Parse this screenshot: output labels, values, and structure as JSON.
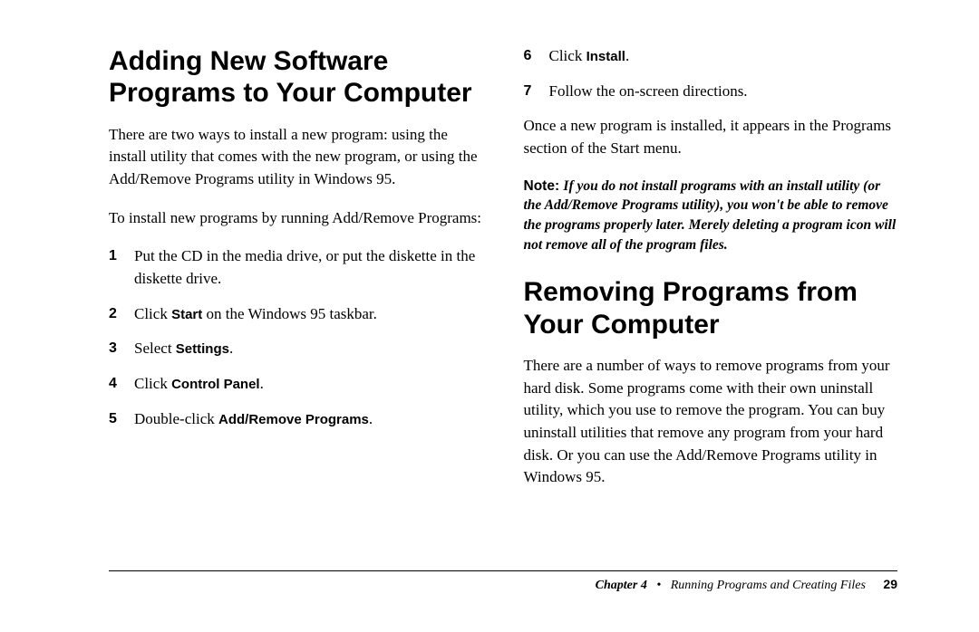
{
  "left": {
    "heading": "Adding New Software Programs to Your Computer",
    "p1": "There are two ways to install a new program: using the install utility that comes with the new program, or using the Add/Remove Programs utility in Windows 95.",
    "p2": "To install new programs by running Add/Remove Programs:",
    "steps": [
      {
        "n": "1",
        "pre": "Put the CD in the media drive, or put the diskette in the diskette drive."
      },
      {
        "n": "2",
        "pre": "Click ",
        "bold": "Start",
        "post": " on the Windows 95 taskbar."
      },
      {
        "n": "3",
        "pre": "Select ",
        "bold": "Settings",
        "post": "."
      },
      {
        "n": "4",
        "pre": "Click ",
        "bold": "Control Panel",
        "post": "."
      },
      {
        "n": "5",
        "pre": "Double-click ",
        "bold": "Add/Remove Programs",
        "post": "."
      }
    ]
  },
  "right": {
    "steps": [
      {
        "n": "6",
        "pre": "Click ",
        "bold": "Install",
        "post": "."
      },
      {
        "n": "7",
        "pre": "Follow the on-screen directions."
      }
    ],
    "p1": "Once a new program is installed, it appears in the Programs section of the Start menu.",
    "noteLabel": "Note: ",
    "noteBody": "If you do not install programs with an install utility (or the Add/Remove Programs utility), you won't be able to remove the programs properly later. Merely deleting a program icon will not remove all of the program files.",
    "heading": "Removing Programs from Your Computer",
    "p2": "There are a number of ways to remove programs from your hard disk. Some programs come with their own uninstall utility, which you use to remove the program. You can buy uninstall utilities that remove any program from your hard disk. Or you can use the Add/Remove Programs utility in Windows 95."
  },
  "footer": {
    "chapter": "Chapter 4",
    "bullet": "•",
    "title": "Running Programs and Creating Files",
    "page": "29"
  }
}
